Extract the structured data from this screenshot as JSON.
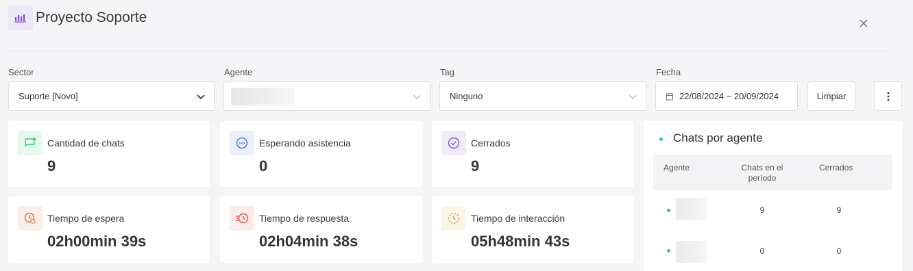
{
  "header": {
    "title": "Proyecto Soporte",
    "logo_icon": "bar-chart-icon",
    "close_icon": "close-icon"
  },
  "filters": {
    "sector": {
      "label": "Sector",
      "value": "Suporte [Novo]"
    },
    "agente": {
      "label": "Agente",
      "value": ""
    },
    "tag": {
      "label": "Tag",
      "value": "Ninguno"
    },
    "fecha": {
      "label": "Fecha",
      "value": "22/08/2024 ~ 20/09/2024"
    },
    "clear_label": "Limpiar",
    "more_icon": "more-vertical-icon"
  },
  "stats": [
    {
      "label": "Cantidad de chats",
      "value": "9",
      "icon": "chat-icon",
      "color": "#2ecc71"
    },
    {
      "label": "Esperando asistencia",
      "value": "0",
      "icon": "dots-circle-icon",
      "color": "#4a78d4"
    },
    {
      "label": "Cerrados",
      "value": "9",
      "icon": "check-circle-icon",
      "color": "#7c5cc4"
    },
    {
      "label": "Tiempo de espera",
      "value": "02h00min 39s",
      "icon": "clock-wait-icon",
      "color": "#d9733f"
    },
    {
      "label": "Tiempo de respuesta",
      "value": "02h04min 38s",
      "icon": "clock-fast-icon",
      "color": "#e04b4b"
    },
    {
      "label": "Tiempo de interacción",
      "value": "05h48min 43s",
      "icon": "clock-dashed-icon",
      "color": "#d9a040"
    }
  ],
  "agents_panel": {
    "title": "Chats por agente",
    "columns": [
      "Agente",
      "Chats en el período",
      "Cerrados"
    ],
    "rows": [
      {
        "agent": "",
        "chats": "9",
        "closed": "9"
      },
      {
        "agent": "",
        "chats": "0",
        "closed": "0"
      }
    ]
  }
}
